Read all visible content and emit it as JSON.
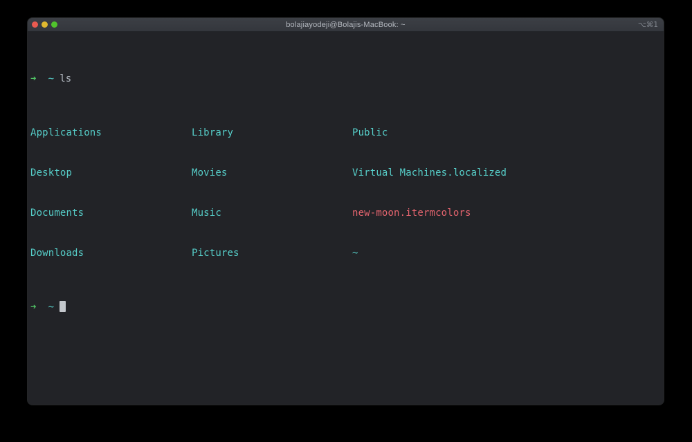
{
  "window": {
    "title": "bolajiayodeji@Bolajis-MacBook: ~",
    "shortcut_badge": "⌥⌘1"
  },
  "terminal": {
    "prompt": {
      "arrow": "➜",
      "path": "~"
    },
    "command": "ls",
    "listing": [
      [
        "Applications",
        "Library",
        "Public"
      ],
      [
        "Desktop",
        "Movies",
        "Virtual Machines.localized"
      ],
      [
        "Documents",
        "Music",
        "new-moon.itermcolors"
      ],
      [
        "Downloads",
        "Pictures",
        "~"
      ]
    ],
    "colors": {
      "background": "#222327",
      "directory_text": "#56cdc8",
      "highlight_file_text": "#e4646e",
      "prompt_arrow": "#50c264",
      "prompt_path": "#56cdc8",
      "command_text": "#b0b6be",
      "cursor": "#c3c7cc"
    }
  }
}
